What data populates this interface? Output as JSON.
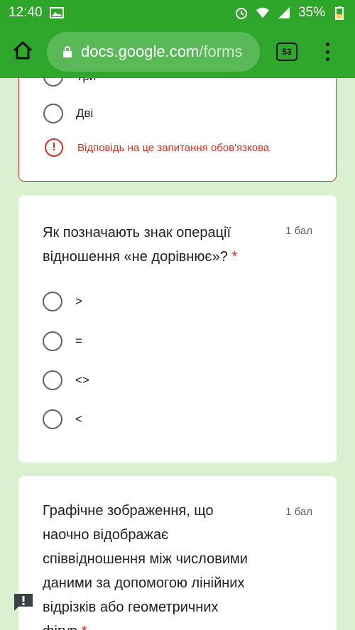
{
  "status": {
    "time": "12:40",
    "battery": "35%"
  },
  "browser": {
    "url_domain": "docs.google.com",
    "url_path": "/forms",
    "tab_count": "53"
  },
  "question1": {
    "partial_option": "Три",
    "option": "Дві",
    "error_text": "Відповідь на це запитання обов'язкова"
  },
  "question2": {
    "title_line1": "Як позначають знак операції",
    "title_line2": "відношення «не дорівнює»?",
    "required_mark": "*",
    "points": "1 бал",
    "options": [
      ">",
      "=",
      "<>",
      "<"
    ]
  },
  "question3": {
    "title_line1": "Графічне зображення, що",
    "title_line2": "наочно відображає",
    "title_line3": "співвідношення між числовими",
    "title_line4": "даними за допомогою лінійних",
    "title_line5": "відрізків або геометричних",
    "title_line6": "фігур",
    "required_mark": "*",
    "points": "1 бал"
  },
  "colors": {
    "toolbar": "#2fa62c",
    "page_background": "#d9f0d1",
    "error": "#d93025"
  },
  "icons": [
    "image-icon",
    "alarm-icon",
    "wifi-icon",
    "signal-icon",
    "battery-icon",
    "home-icon",
    "lock-icon",
    "more-vert-icon",
    "error-icon",
    "feedback-icon"
  ]
}
